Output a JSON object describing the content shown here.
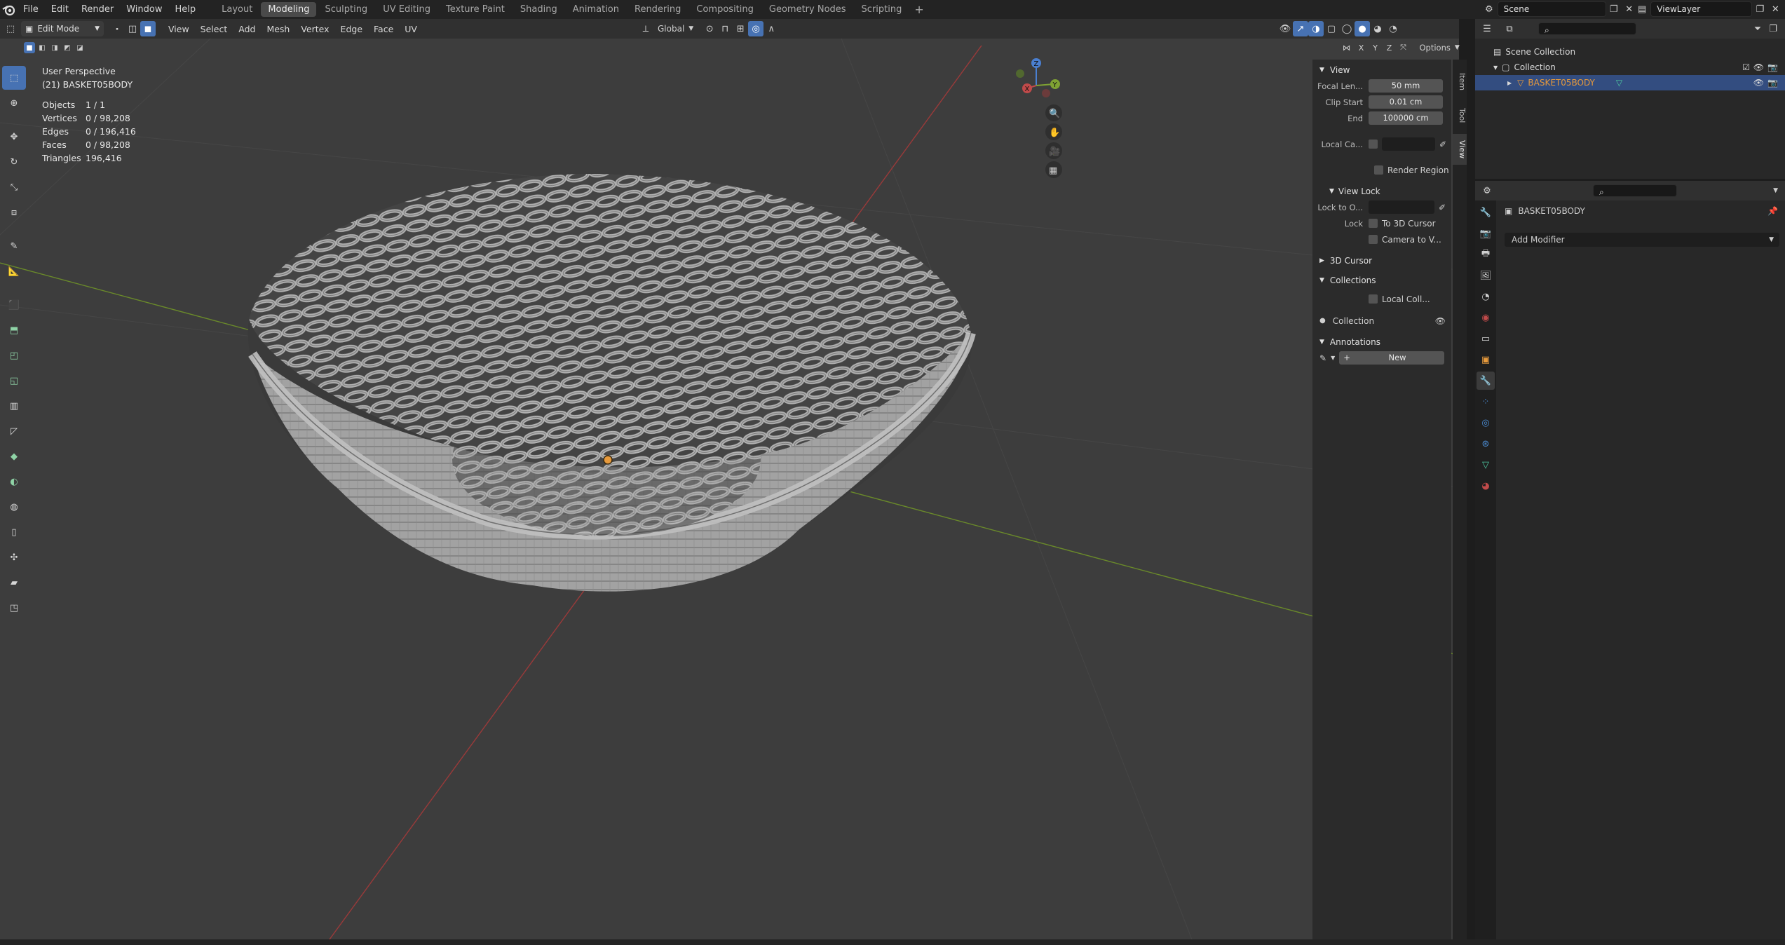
{
  "topbar": {
    "menus": [
      "File",
      "Edit",
      "Render",
      "Window",
      "Help"
    ],
    "workspaces": [
      "Layout",
      "Modeling",
      "Sculpting",
      "UV Editing",
      "Texture Paint",
      "Shading",
      "Animation",
      "Rendering",
      "Compositing",
      "Geometry Nodes",
      "Scripting"
    ],
    "active_workspace": "Modeling",
    "add_workspace": "+",
    "scene": "Scene",
    "view_layer": "ViewLayer"
  },
  "viewport_header": {
    "mode": "Edit Mode",
    "menus": [
      "View",
      "Select",
      "Add",
      "Mesh",
      "Vertex",
      "Edge",
      "Face",
      "UV"
    ],
    "orientation": "Global",
    "options_label": "Options",
    "axes": [
      "X",
      "Y",
      "Z"
    ]
  },
  "overlay": {
    "perspective": "User Perspective",
    "object_name": "(21) BASKET05BODY",
    "stats": [
      {
        "label": "Objects",
        "value": "1 / 1"
      },
      {
        "label": "Vertices",
        "value": "0 / 98,208"
      },
      {
        "label": "Edges",
        "value": "0 / 196,416"
      },
      {
        "label": "Faces",
        "value": "0 / 98,208"
      },
      {
        "label": "Triangles",
        "value": "196,416"
      }
    ]
  },
  "gizmo": {
    "x": "X",
    "y": "Y",
    "z": "Z"
  },
  "npanel": {
    "tabs": [
      "Item",
      "Tool",
      "View"
    ],
    "active_tab": "View",
    "view_section": "View",
    "focal_length_label": "Focal Len...",
    "focal_length": "50 mm",
    "clip_start_label": "Clip Start",
    "clip_start": "0.01 cm",
    "end_label": "End",
    "end": "100000 cm",
    "local_camera_label": "Local Ca...",
    "render_region": "Render Region",
    "view_lock_section": "View Lock",
    "lock_to_object_label": "Lock to O...",
    "lock_label": "Lock",
    "to_3d_cursor": "To 3D Cursor",
    "camera_to_view": "Camera to V...",
    "cursor_section": "3D Cursor",
    "collections_section": "Collections",
    "local_collections": "Local Coll...",
    "collection_item": "Collection",
    "annotations_section": "Annotations",
    "new_button": "New"
  },
  "outliner": {
    "scene_collection": "Scene Collection",
    "collection": "Collection",
    "object": "BASKET05BODY"
  },
  "properties": {
    "object": "BASKET05BODY",
    "add_modifier": "Add Modifier"
  },
  "colors": {
    "accent": "#4772b3",
    "x_axis": "#c04a4a",
    "y_axis": "#7fa233",
    "z_axis": "#4a7fd0",
    "object_orange": "#e79a3c"
  }
}
